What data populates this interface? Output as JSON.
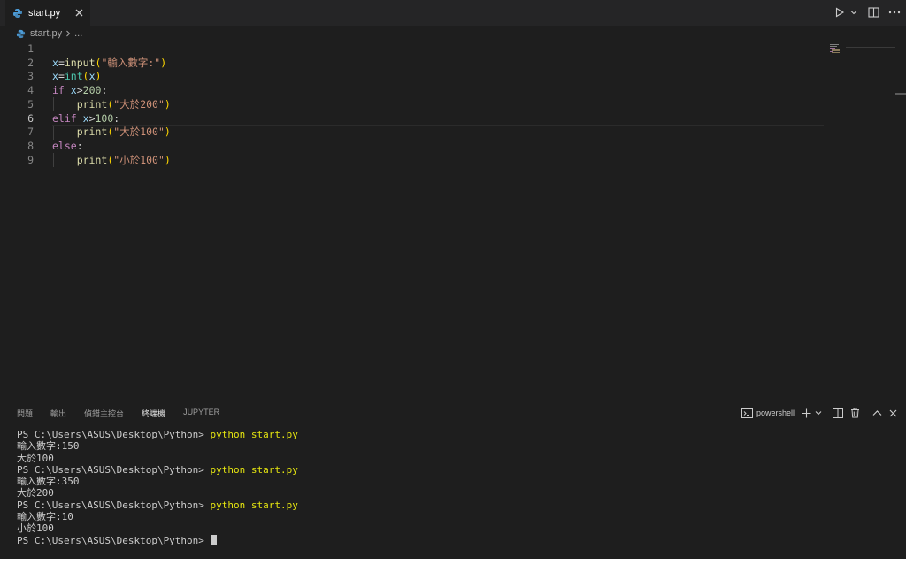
{
  "tab": {
    "label": "start.py"
  },
  "breadcrumb": {
    "file": "start.py",
    "more": "..."
  },
  "editor": {
    "line_numbers": [
      "1",
      "2",
      "3",
      "4",
      "5",
      "6",
      "7",
      "8",
      "9"
    ],
    "lines": [
      {
        "tokens": []
      },
      {
        "tokens": [
          {
            "t": "x",
            "c": "c-var"
          },
          {
            "t": "=",
            "c": "c-op"
          },
          {
            "t": "input",
            "c": "c-fn"
          },
          {
            "t": "(",
            "c": "c-paren"
          },
          {
            "t": "\"輸入數字:\"",
            "c": "c-str"
          },
          {
            "t": ")",
            "c": "c-paren"
          }
        ]
      },
      {
        "tokens": [
          {
            "t": "x",
            "c": "c-var"
          },
          {
            "t": "=",
            "c": "c-op"
          },
          {
            "t": "int",
            "c": "c-builtin"
          },
          {
            "t": "(",
            "c": "c-paren"
          },
          {
            "t": "x",
            "c": "c-var"
          },
          {
            "t": ")",
            "c": "c-paren"
          }
        ]
      },
      {
        "tokens": [
          {
            "t": "if ",
            "c": "c-kw"
          },
          {
            "t": "x",
            "c": "c-var"
          },
          {
            "t": ">",
            "c": "c-op"
          },
          {
            "t": "200",
            "c": "c-num"
          },
          {
            "t": ":",
            "c": "c-op"
          }
        ]
      },
      {
        "tokens": [
          {
            "t": "    ",
            "c": "c-op"
          },
          {
            "t": "print",
            "c": "c-fn"
          },
          {
            "t": "(",
            "c": "c-paren"
          },
          {
            "t": "\"大於200\"",
            "c": "c-str"
          },
          {
            "t": ")",
            "c": "c-paren"
          }
        ]
      },
      {
        "tokens": [
          {
            "t": "elif ",
            "c": "c-kw"
          },
          {
            "t": "x",
            "c": "c-var"
          },
          {
            "t": ">",
            "c": "c-op"
          },
          {
            "t": "100",
            "c": "c-num"
          },
          {
            "t": ":",
            "c": "c-op"
          }
        ]
      },
      {
        "tokens": [
          {
            "t": "    ",
            "c": "c-op"
          },
          {
            "t": "print",
            "c": "c-fn"
          },
          {
            "t": "(",
            "c": "c-paren"
          },
          {
            "t": "\"大於100\"",
            "c": "c-str"
          },
          {
            "t": ")",
            "c": "c-paren"
          }
        ]
      },
      {
        "tokens": [
          {
            "t": "else",
            "c": "c-kw"
          },
          {
            "t": ":",
            "c": "c-op"
          }
        ]
      },
      {
        "tokens": [
          {
            "t": "    ",
            "c": "c-op"
          },
          {
            "t": "print",
            "c": "c-fn"
          },
          {
            "t": "(",
            "c": "c-paren"
          },
          {
            "t": "\"小於100\"",
            "c": "c-str"
          },
          {
            "t": ")",
            "c": "c-paren"
          }
        ]
      }
    ]
  },
  "panel": {
    "tabs": [
      "問題",
      "輸出",
      "偵錯主控台",
      "終端機",
      "JUPYTER"
    ],
    "active_tab": "終端機",
    "terminal_name": "powershell"
  },
  "terminal": {
    "prompt": "PS C:\\Users\\ASUS\\Desktop\\Python> ",
    "command": "python start.py",
    "lines": [
      {
        "type": "cmd"
      },
      {
        "type": "out",
        "text": "輸入數字:150"
      },
      {
        "type": "out",
        "text": "大於100"
      },
      {
        "type": "cmd"
      },
      {
        "type": "out",
        "text": "輸入數字:350"
      },
      {
        "type": "out",
        "text": "大於200"
      },
      {
        "type": "cmd"
      },
      {
        "type": "out",
        "text": "輸入數字:10"
      },
      {
        "type": "out",
        "text": "小於100"
      },
      {
        "type": "prompt"
      }
    ]
  },
  "colors": {
    "background": "#1e1e1e",
    "tab_bar": "#252526",
    "keyword": "#c586c0",
    "string": "#ce9178",
    "function": "#dcdcaa",
    "command_yellow": "#e5e510"
  }
}
